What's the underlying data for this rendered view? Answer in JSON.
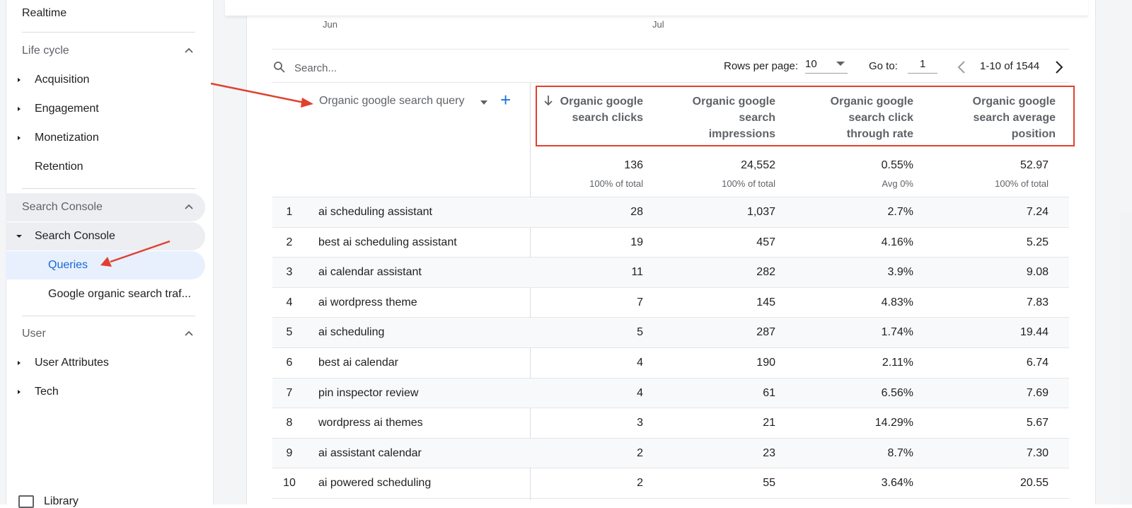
{
  "sidebar": {
    "realtime": "Realtime",
    "lifecycle": {
      "title": "Life cycle",
      "items": [
        "Acquisition",
        "Engagement",
        "Monetization",
        "Retention"
      ]
    },
    "search_console": {
      "title": "Search Console",
      "group": "Search Console",
      "items": [
        "Queries",
        "Google organic search traf..."
      ],
      "selected": "Queries"
    },
    "user": {
      "title": "User",
      "items": [
        "User Attributes",
        "Tech"
      ]
    },
    "library": "Library"
  },
  "chart_axis": {
    "labels": [
      "Jun",
      "Jul"
    ]
  },
  "toolbar": {
    "search_placeholder": "Search...",
    "rows_per_page_label": "Rows per page:",
    "rows_per_page_value": "10",
    "goto_label": "Go to:",
    "goto_value": "1",
    "page_range": "1-10 of 1544"
  },
  "table": {
    "dimension_header": "Organic google search query",
    "metric_headers": [
      [
        "Organic google",
        "search clicks"
      ],
      [
        "Organic google",
        "search",
        "impressions"
      ],
      [
        "Organic google",
        "search click",
        "through rate"
      ],
      [
        "Organic google",
        "search average",
        "position"
      ]
    ],
    "totals": {
      "values": [
        "136",
        "24,552",
        "0.55%",
        "52.97"
      ],
      "subs": [
        "100% of total",
        "100% of total",
        "Avg 0%",
        "100% of total"
      ]
    },
    "rows": [
      {
        "idx": "1",
        "query": "ai scheduling assistant",
        "clicks": "28",
        "impressions": "1,037",
        "ctr": "2.7%",
        "position": "7.24"
      },
      {
        "idx": "2",
        "query": "best ai scheduling assistant",
        "clicks": "19",
        "impressions": "457",
        "ctr": "4.16%",
        "position": "5.25"
      },
      {
        "idx": "3",
        "query": "ai calendar assistant",
        "clicks": "11",
        "impressions": "282",
        "ctr": "3.9%",
        "position": "9.08"
      },
      {
        "idx": "4",
        "query": "ai wordpress theme",
        "clicks": "7",
        "impressions": "145",
        "ctr": "4.83%",
        "position": "7.83"
      },
      {
        "idx": "5",
        "query": "ai scheduling",
        "clicks": "5",
        "impressions": "287",
        "ctr": "1.74%",
        "position": "19.44"
      },
      {
        "idx": "6",
        "query": "best ai calendar",
        "clicks": "4",
        "impressions": "190",
        "ctr": "2.11%",
        "position": "6.74"
      },
      {
        "idx": "7",
        "query": "pin inspector review",
        "clicks": "4",
        "impressions": "61",
        "ctr": "6.56%",
        "position": "7.69"
      },
      {
        "idx": "8",
        "query": "wordpress ai themes",
        "clicks": "3",
        "impressions": "21",
        "ctr": "14.29%",
        "position": "5.67"
      },
      {
        "idx": "9",
        "query": "ai assistant calendar",
        "clicks": "2",
        "impressions": "23",
        "ctr": "8.7%",
        "position": "7.30"
      },
      {
        "idx": "10",
        "query": "ai powered scheduling",
        "clicks": "2",
        "impressions": "55",
        "ctr": "3.64%",
        "position": "20.55"
      }
    ]
  },
  "colors": {
    "accent": "#1a73e8",
    "selected_bg": "#e8f0fe",
    "annotation": "#e0412f"
  }
}
